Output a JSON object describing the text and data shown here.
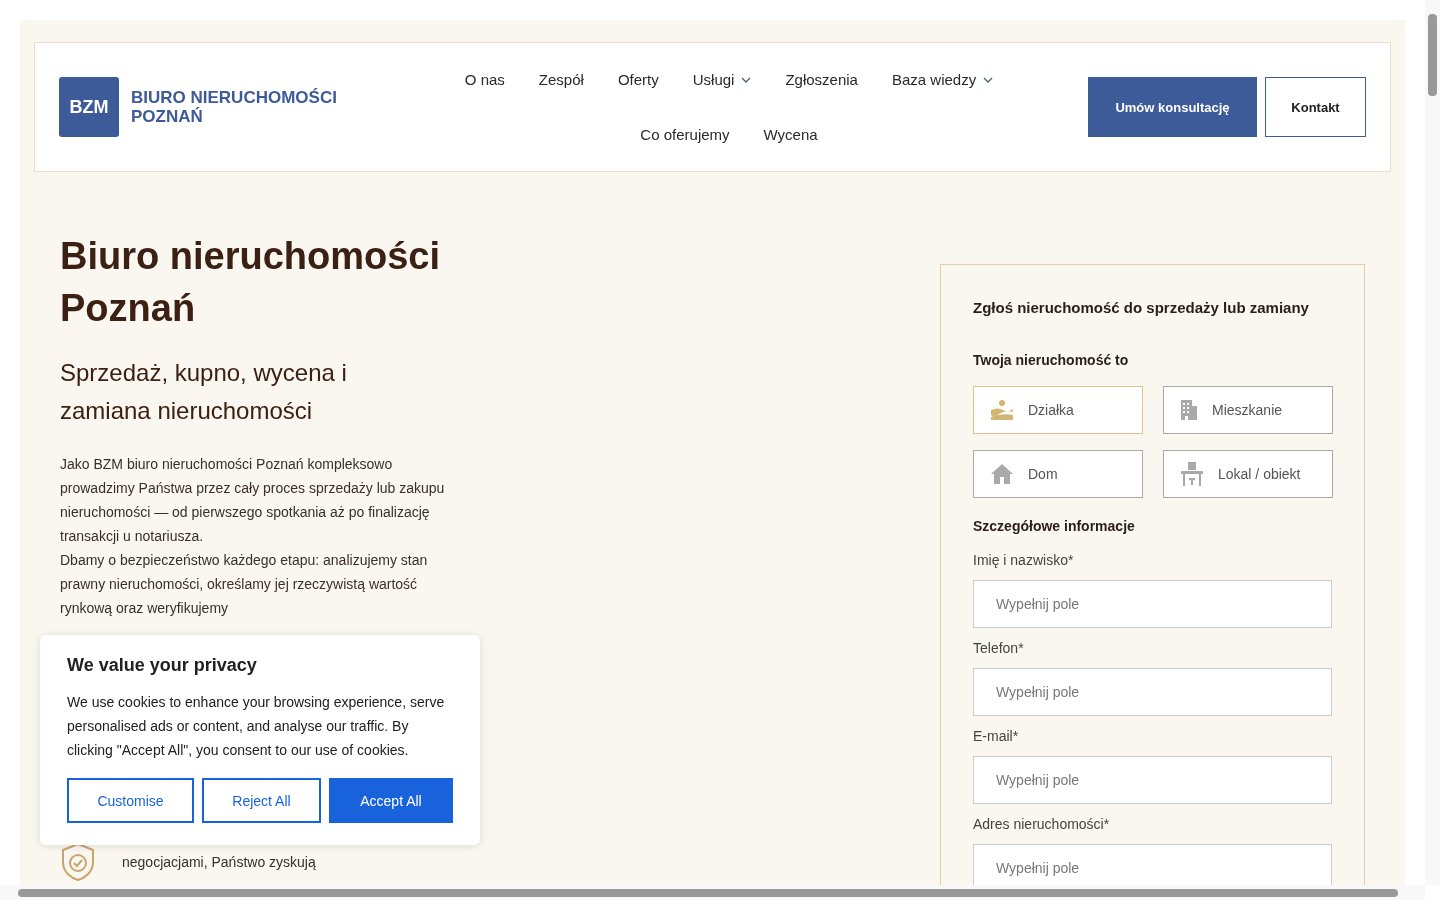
{
  "header": {
    "logo_mark": "BZM",
    "logo_text": [
      "BIURO NIERUCHOMOŚCI",
      "POZNAŃ"
    ],
    "nav": [
      {
        "label": "O nas",
        "has_menu": false
      },
      {
        "label": "Zespół",
        "has_menu": false
      },
      {
        "label": "Oferty",
        "has_menu": false
      },
      {
        "label": "Usługi",
        "has_menu": true
      },
      {
        "label": "Zgłoszenia",
        "has_menu": false
      },
      {
        "label": "Baza wiedzy",
        "has_menu": true
      },
      {
        "label": "Co oferujemy",
        "has_menu": false
      },
      {
        "label": "Wycena",
        "has_menu": false
      }
    ],
    "buttons": [
      {
        "label": "Umów konsultację",
        "kind": "primary"
      },
      {
        "label": "Kontakt",
        "kind": "outline"
      }
    ]
  },
  "hero": {
    "title": "Biuro nieruchomości Poznań",
    "subtitle": "Sprzedaż, kupno, wycena i zamiana nieruchomości",
    "paragraphs": [
      "Jako BZM biuro nieruchomości Poznań kompleksowo prowadzimy Państwa przez cały proces sprzedaży lub zakupu nieruchomości — od pierwszego spotkania aż po finalizację transakcji u notariusza.",
      "Dbamy o bezpieczeństwo każdego etapu: analizujemy stan prawny nieruchomości, określamy jej rzeczywistą wartość rynkową oraz weryfikujemy"
    ],
    "feature": "negocjacjami, Państwo zyskują"
  },
  "form": {
    "title": "Zgłoś nieruchomość do sprzedaży lub zamiany",
    "type_label": "Twoja nieruchomość to",
    "types": [
      {
        "label": "Działka",
        "kind": "land",
        "selected": true
      },
      {
        "label": "Mieszkanie",
        "kind": "apartment",
        "selected": false
      },
      {
        "label": "Dom",
        "kind": "house",
        "selected": false
      },
      {
        "label": "Lokal / obiekt",
        "kind": "office",
        "selected": false
      }
    ],
    "details_label": "Szczegółowe informacje",
    "fields": [
      {
        "label": "Imię i nazwisko*",
        "placeholder": "Wypełnij pole"
      },
      {
        "label": "Telefon*",
        "placeholder": "Wypełnij pole"
      },
      {
        "label": "E-mail*",
        "placeholder": "Wypełnij pole"
      },
      {
        "label": "Adres nieruchomości*",
        "placeholder": "Wypełnij pole"
      }
    ]
  },
  "cookie_banner": {
    "title": "We value your privacy",
    "text": "We use cookies to enhance your browsing experience, serve personalised ads or content, and analyse our traffic. By clicking \"Accept All\", you consent to our use of cookies.",
    "buttons": [
      {
        "label": "Customise",
        "kind": "outline"
      },
      {
        "label": "Reject All",
        "kind": "outline"
      },
      {
        "label": "Accept All",
        "kind": "primary"
      }
    ]
  }
}
